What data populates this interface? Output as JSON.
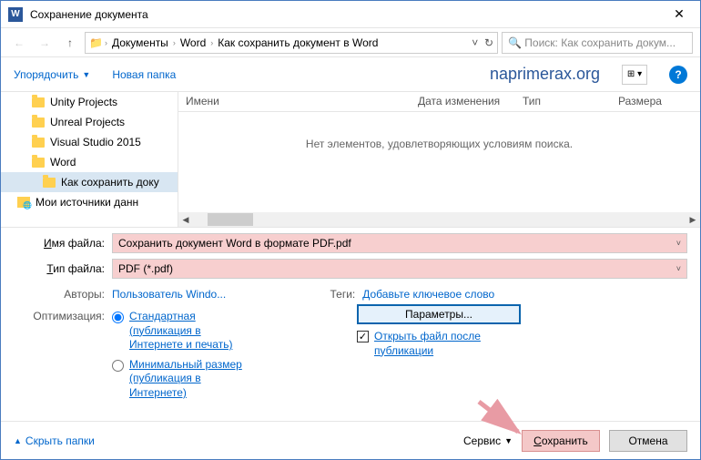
{
  "titlebar": {
    "title": "Сохранение документа",
    "app_letter": "W"
  },
  "nav": {
    "breadcrumb": [
      "Документы",
      "Word",
      "Как сохранить документ в Word"
    ],
    "search_placeholder": "Поиск: Как сохранить докум..."
  },
  "toolbar": {
    "organize": "Упорядочить",
    "new_folder": "Новая папка",
    "brand": "naprimerax.org"
  },
  "sidebar": {
    "items": [
      "Unity Projects",
      "Unreal Projects",
      "Visual Studio 2015",
      "Word",
      "Как сохранить доку",
      "Мои источники данн"
    ]
  },
  "fileview": {
    "columns": {
      "name": "Имени",
      "date": "Дата изменения",
      "type": "Тип",
      "size": "Размера"
    },
    "empty_msg": "Нет элементов, удовлетворяющих условиям поиска."
  },
  "form": {
    "filename_label": "Имя файла:",
    "filename_value": "Сохранить документ Word в формате PDF.pdf",
    "filetype_label": "Тип файла:",
    "filetype_value": "PDF (*.pdf)",
    "authors_label": "Авторы:",
    "authors_value": "Пользователь Windo...",
    "tags_label": "Теги:",
    "tags_value": "Добавьте ключевое слово",
    "optimization_label": "Оптимизация:",
    "radio1": "Стандартная (публикация в Интернете и печать)",
    "radio2": "Минимальный размер (публикация в Интернете)",
    "params_button": "Параметры...",
    "checkbox_label": "Открыть файл после публикации"
  },
  "footer": {
    "hide": "Скрыть папки",
    "tools": "Сервис",
    "save": "Сохранить",
    "cancel": "Отмена"
  }
}
